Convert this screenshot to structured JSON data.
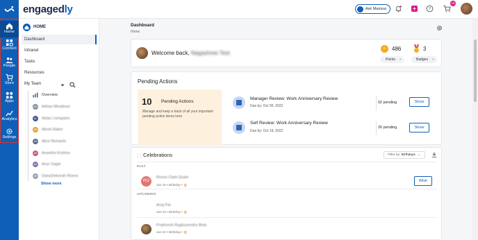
{
  "brand": {
    "name_a": "engaged",
    "name_b": "ly"
  },
  "colors": {
    "primary": "#0f5fb8",
    "accent": "#d81b8a",
    "pending_bg": "#fdf1de",
    "highlight_border": "#d9342b"
  },
  "rail": {
    "items": [
      {
        "label": "Home",
        "icon": "home-icon"
      },
      {
        "label": "Connect",
        "icon": "connect-icon"
      },
      {
        "label": "People",
        "icon": "people-icon"
      },
      {
        "label": "Store",
        "icon": "cart-icon"
      },
      {
        "label": "Apps",
        "icon": "apps-icon"
      },
      {
        "label": "Analytics",
        "icon": "analytics-icon"
      },
      {
        "label": "Settings",
        "icon": "gear-icon"
      }
    ]
  },
  "topbar": {
    "ask": "Ask Marissa",
    "cart_badge": "15"
  },
  "subnav": {
    "home_label": "HOME",
    "items": [
      "Dashboard",
      "Intranet",
      "Tasks",
      "Resources",
      "My Team"
    ],
    "overview": "Overview",
    "team": [
      {
        "initials": "AM",
        "name": "Adrian Meadows",
        "color": "#7f8fa6"
      },
      {
        "initials": "AL",
        "name": "Aidan Livingston",
        "color": "#3e5c9a"
      },
      {
        "initials": "AB",
        "name": "Alexis Baker",
        "color": "#e2a33b"
      },
      {
        "initials": "AR",
        "name": "Alice Richards",
        "color": "#5b6b8c"
      },
      {
        "initials": "AK",
        "name": "Anantha Krishna",
        "color": "#c65a7d"
      },
      {
        "initials": "AS",
        "name": "Arun Sagar",
        "color": "#8a6fb0"
      },
      {
        "initials": "DR",
        "name": "DaisyDeborah Rivera",
        "color": "#9aa0aa"
      }
    ],
    "show_more": "Show more"
  },
  "page": {
    "title": "Dashboard",
    "breadcrumb": "Home"
  },
  "welcome": {
    "greeting": "Welcome back,",
    "name": "Nagashree Test",
    "points": "486",
    "points_label": "Points",
    "badges": "3",
    "badges_label": "Badges"
  },
  "pending": {
    "title": "Pending Actions",
    "count": "10",
    "count_label": "Pending Actions",
    "description": "Manage and keep a track of all your important pending action items here",
    "rows": [
      {
        "title": "Manager Review: Work Anniversary Review",
        "due": "Due by: Oct 05, 2022",
        "count": "02 pending",
        "action": "Show"
      },
      {
        "title": "Self Review: Work Anniversary Review",
        "due": "Due by: Oct 19, 2022",
        "count": "26 pending",
        "action": "Show"
      }
    ]
  },
  "celebrations": {
    "title": "Celebrations",
    "filter_prefix": "Filter by:",
    "filter_value": "Birthdays",
    "past_label": "PAST",
    "upcoming_label": "UPCOMING",
    "past": [
      {
        "initials": "RO",
        "name": "Rovoo Clark Quain",
        "meta": "Jan 15 • Birthday •",
        "action": "Wish",
        "color": "#e57373"
      }
    ],
    "upcoming": [
      {
        "initials": "",
        "name": "Anoj Pal",
        "meta": "Jan 23 • Birthday •"
      },
      {
        "initials": "",
        "name": "Prathvesh Raghuvendra Bhat",
        "meta": "Jan 24 • Birthday •"
      }
    ]
  }
}
